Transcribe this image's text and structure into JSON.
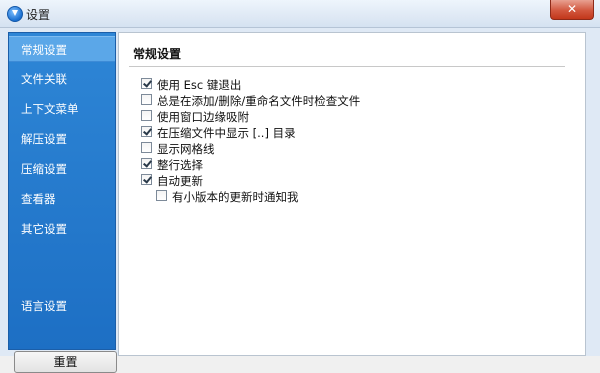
{
  "window": {
    "title": "设置",
    "close_label": "✕"
  },
  "sidebar": {
    "items": [
      {
        "label": "常规设置",
        "active": true
      },
      {
        "label": "文件关联",
        "active": false
      },
      {
        "label": "上下文菜单",
        "active": false
      },
      {
        "label": "解压设置",
        "active": false
      },
      {
        "label": "压缩设置",
        "active": false
      },
      {
        "label": "查看器",
        "active": false
      },
      {
        "label": "其它设置",
        "active": false
      }
    ],
    "language_label": "语言设置",
    "reset_label": "重置"
  },
  "content": {
    "section_title": "常规设置",
    "options": [
      {
        "label": "使用 Esc 键退出",
        "checked": true,
        "indent": false
      },
      {
        "label": "总是在添加/删除/重命名文件时检查文件",
        "checked": false,
        "indent": false
      },
      {
        "label": "使用窗口边缘吸附",
        "checked": false,
        "indent": false
      },
      {
        "label": "在压缩文件中显示 [..] 目录",
        "checked": true,
        "indent": false
      },
      {
        "label": "显示网格线",
        "checked": false,
        "indent": false
      },
      {
        "label": "整行选择",
        "checked": true,
        "indent": false
      },
      {
        "label": "自动更新",
        "checked": true,
        "indent": false
      },
      {
        "label": "有小版本的更新时通知我",
        "checked": false,
        "indent": true
      }
    ]
  },
  "colors": {
    "sidebar": "#2479cc",
    "sidebar_active": "#5ba7e8",
    "close_button": "#c9442a"
  }
}
